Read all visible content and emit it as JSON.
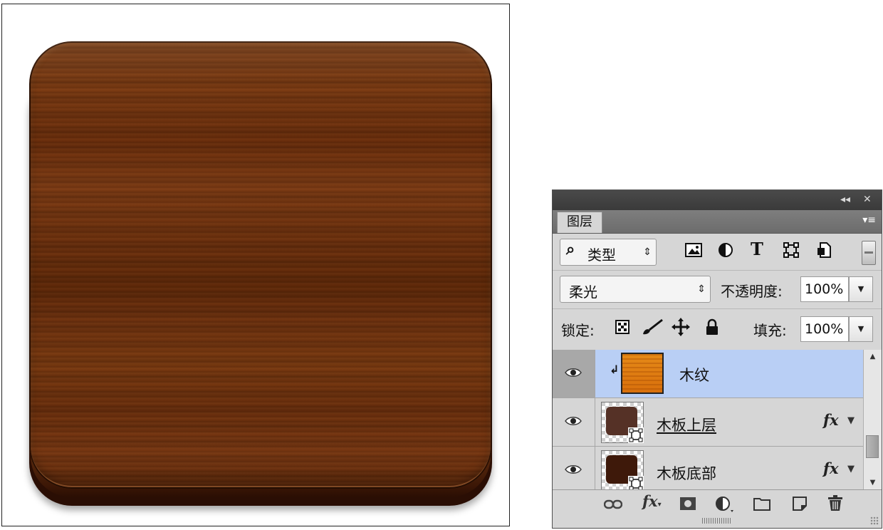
{
  "colors": {
    "selected_row": "#b9cff5",
    "panel_bg": "#d6d6d6",
    "titlebar": "#3f3f3f",
    "layer_thumb_orange": "#e07a10",
    "layer_thumb_dark1": "#5a3328",
    "layer_thumb_dark2": "#3e1a0a"
  },
  "panel": {
    "collapse_icon": "◂◂",
    "close_icon": "✕",
    "menu_icon": "▾≡",
    "tab_label": "图层"
  },
  "filter": {
    "search_glyph": "⌕",
    "kind_label": "类型",
    "spinner": "⇕",
    "icons": [
      "image-filter-icon",
      "adjustment-filter-icon",
      "type-filter-icon",
      "shape-filter-icon",
      "smart-object-filter-icon"
    ]
  },
  "blend": {
    "mode": "柔光",
    "opacity_label": "不透明度:",
    "opacity_value": "100%"
  },
  "lock": {
    "label": "锁定:",
    "fill_label": "填充:",
    "fill_value": "100%"
  },
  "layers": [
    {
      "name": "木纹",
      "visible": true,
      "selected": true,
      "clipped": true,
      "has_fx": false
    },
    {
      "name": "木板上层",
      "visible": true,
      "selected": false,
      "clipped": false,
      "has_fx": true
    },
    {
      "name": "木板底部",
      "visible": true,
      "selected": false,
      "clipped": false,
      "has_fx": true
    }
  ],
  "fx_label": "fx",
  "bottom_bar": [
    "link-layers-icon",
    "layer-style-icon",
    "add-mask-icon",
    "adjustment-layer-icon",
    "new-group-icon",
    "new-layer-icon",
    "delete-layer-icon"
  ]
}
